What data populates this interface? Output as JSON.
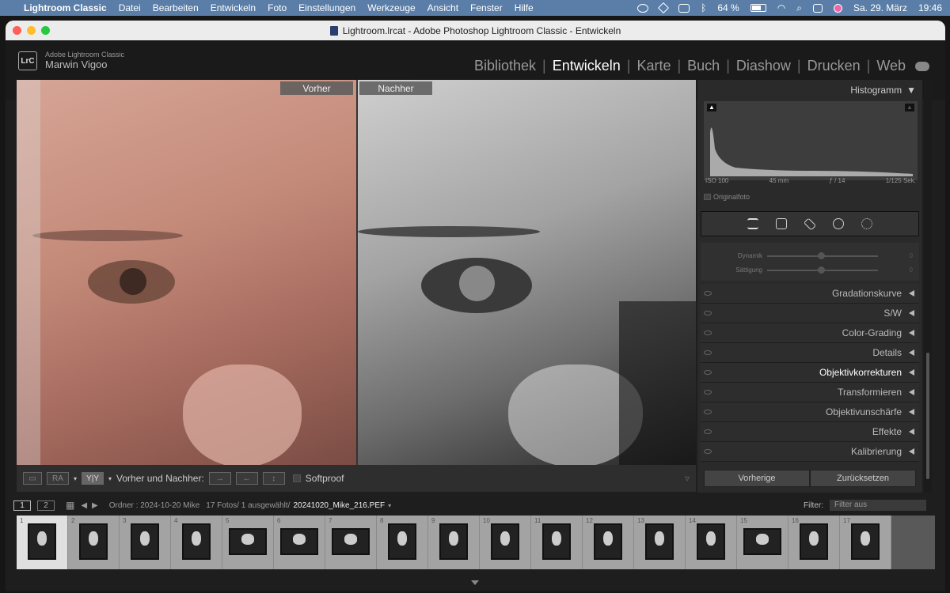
{
  "menubar": {
    "app_name": "Lightroom Classic",
    "items": [
      "Datei",
      "Bearbeiten",
      "Entwickeln",
      "Foto",
      "Einstellungen",
      "Werkzeuge",
      "Ansicht",
      "Fenster",
      "Hilfe"
    ],
    "battery": "64 %",
    "datetime": "Sa. 29. März",
    "time": "19:46"
  },
  "window": {
    "title": "Lightroom.lrcat - Adobe Photoshop Lightroom Classic - Entwickeln"
  },
  "identity": {
    "product": "Adobe Lightroom Classic",
    "user": "Marwin Vigoo",
    "logo": "LrC"
  },
  "modules": {
    "items": [
      "Bibliothek",
      "Entwickeln",
      "Karte",
      "Buch",
      "Diashow",
      "Drucken",
      "Web"
    ],
    "active": "Entwickeln"
  },
  "viewer": {
    "before_label": "Vorher",
    "after_label": "Nachher"
  },
  "toolbar": {
    "before_after_label": "Vorher und Nachher:",
    "softproof_label": "Softproof",
    "ra_label": "RA",
    "yy_label": "Y|Y"
  },
  "histogram": {
    "title": "Histogramm",
    "iso": "ISO 100",
    "focal": "45 mm",
    "aperture": "ƒ / 14",
    "shutter": "1/125 Sek.",
    "original_label": "Originalfoto"
  },
  "sliders": [
    {
      "name": "Dynamik",
      "value": "0",
      "position": 0.5
    },
    {
      "name": "Sättigung",
      "value": "0",
      "position": 0.5
    }
  ],
  "sections": [
    {
      "label": "Gradationskurve",
      "active": false
    },
    {
      "label": "S/W",
      "active": false
    },
    {
      "label": "Color-Grading",
      "active": false
    },
    {
      "label": "Details",
      "active": false
    },
    {
      "label": "Objektivkorrekturen",
      "active": true
    },
    {
      "label": "Transformieren",
      "active": false
    },
    {
      "label": "Objektivunschärfe",
      "active": false
    },
    {
      "label": "Effekte",
      "active": false
    },
    {
      "label": "Kalibrierung",
      "active": false
    }
  ],
  "buttons": {
    "previous": "Vorherige",
    "reset": "Zurücksetzen"
  },
  "filmstrip_bar": {
    "page1": "1",
    "page2": "2",
    "folder": "Ordner : 2024-10-20 Mike",
    "count": "17 Fotos/ 1 ausgewählt/",
    "filename": "20241020_Mike_216.PEF",
    "filter_label": "Filter:",
    "filter_value": "Filter aus"
  },
  "filmstrip": {
    "selected_index": 0,
    "items": [
      {
        "num": "1",
        "orient": "portrait"
      },
      {
        "num": "2",
        "orient": "portrait"
      },
      {
        "num": "3",
        "orient": "portrait"
      },
      {
        "num": "4",
        "orient": "portrait"
      },
      {
        "num": "5",
        "orient": "landscape"
      },
      {
        "num": "6",
        "orient": "landscape"
      },
      {
        "num": "7",
        "orient": "landscape"
      },
      {
        "num": "8",
        "orient": "portrait"
      },
      {
        "num": "9",
        "orient": "portrait"
      },
      {
        "num": "10",
        "orient": "portrait"
      },
      {
        "num": "11",
        "orient": "portrait"
      },
      {
        "num": "12",
        "orient": "portrait"
      },
      {
        "num": "13",
        "orient": "portrait"
      },
      {
        "num": "14",
        "orient": "portrait"
      },
      {
        "num": "15",
        "orient": "landscape"
      },
      {
        "num": "16",
        "orient": "portrait"
      },
      {
        "num": "17",
        "orient": "portrait"
      }
    ]
  }
}
